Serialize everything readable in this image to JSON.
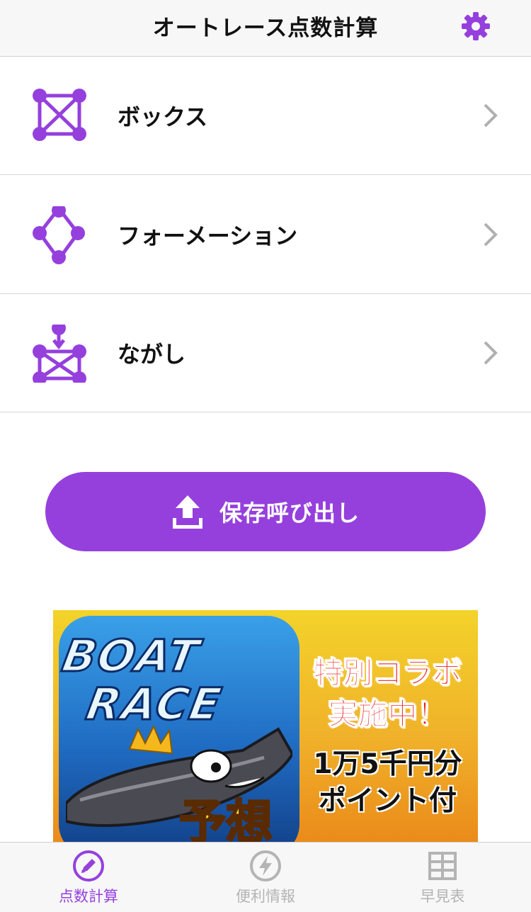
{
  "header": {
    "title": "オートレース点数計算",
    "settings_icon": "gear-icon"
  },
  "menu": {
    "items": [
      {
        "label": "ボックス",
        "icon": "box-bet-icon"
      },
      {
        "label": "フォーメーション",
        "icon": "formation-bet-icon"
      },
      {
        "label": "ながし",
        "icon": "nagashi-bet-icon"
      }
    ]
  },
  "load_button": {
    "label": "保存呼び出し",
    "icon": "upload-icon"
  },
  "ad": {
    "boat_line1": "BOAT",
    "boat_line2": "RACE",
    "yosou": "予想",
    "collab_line1": "特別コラボ",
    "collab_line2": "実施中！",
    "points_line1": "1万5千円分",
    "points_line2": "ポイント付"
  },
  "tabs": [
    {
      "label": "点数計算",
      "icon": "pencil-icon",
      "active": true
    },
    {
      "label": "便利情報",
      "icon": "lightning-icon",
      "active": false
    },
    {
      "label": "早見表",
      "icon": "grid-table-icon",
      "active": false
    }
  ],
  "colors": {
    "accent": "#9540dd",
    "inactive": "#b4b4b4",
    "chevron": "#b0b0b0"
  }
}
